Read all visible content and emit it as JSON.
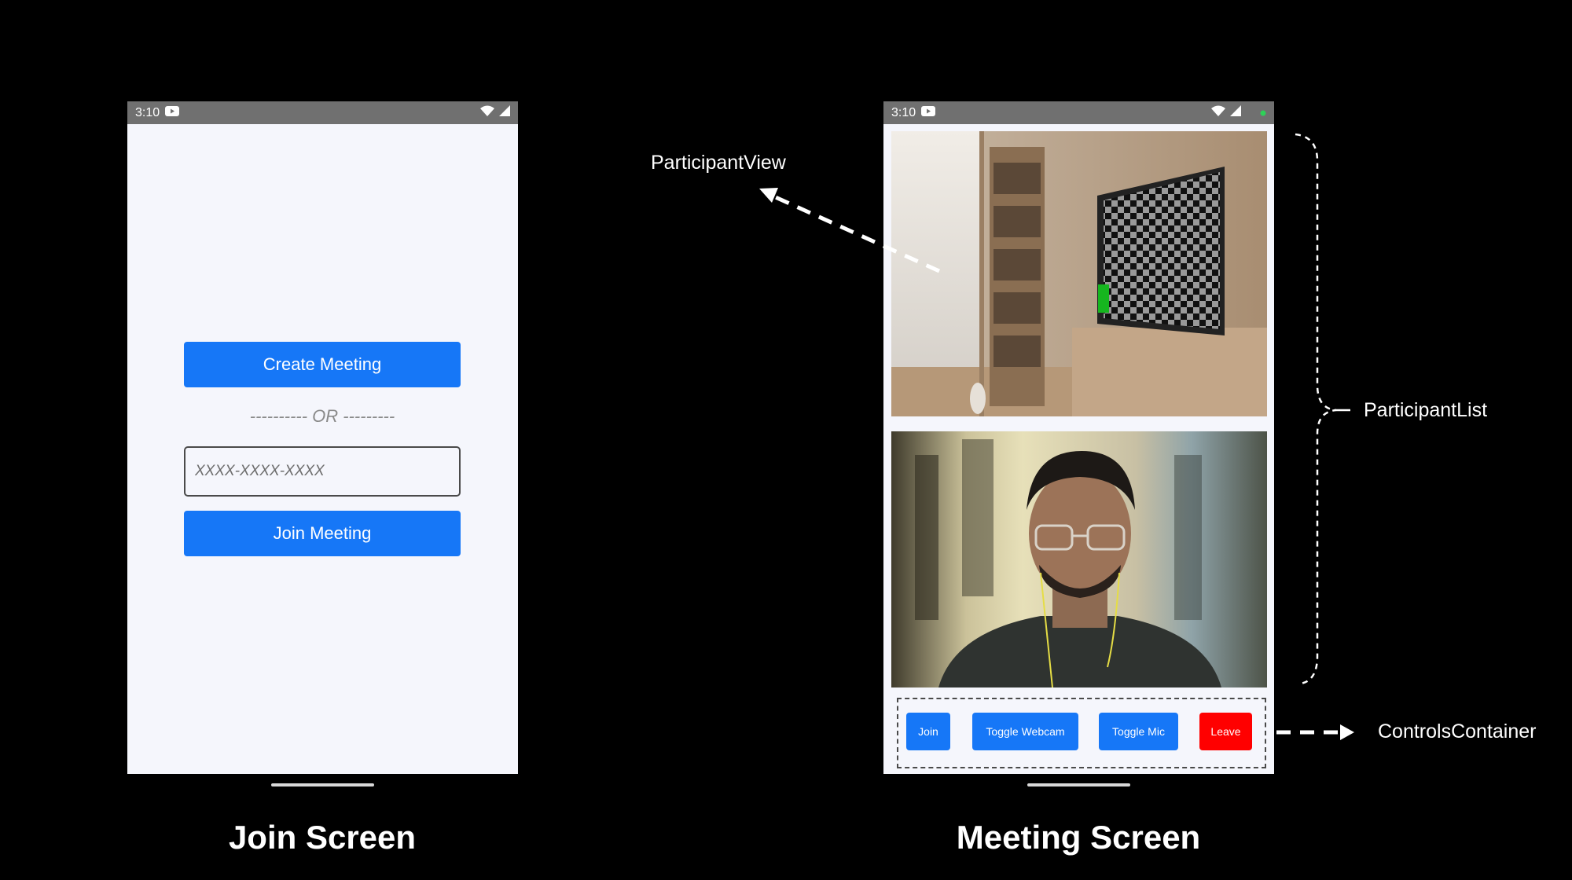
{
  "join_screen": {
    "status_time": "3:10",
    "create_button_label": "Create Meeting",
    "or_text": "---------- OR ---------",
    "meeting_id_placeholder": "XXXX-XXXX-XXXX",
    "join_button_label": "Join Meeting",
    "caption": "Join Screen"
  },
  "meeting_screen": {
    "status_time": "3:10",
    "controls": {
      "join_label": "Join",
      "toggle_webcam_label": "Toggle Webcam",
      "toggle_mic_label": "Toggle Mic",
      "leave_label": "Leave"
    },
    "caption": "Meeting Screen"
  },
  "annotations": {
    "participant_view": "ParticipantView",
    "participant_list": "ParticipantList",
    "controls_container": "ControlsContainer"
  },
  "colors": {
    "background": "#000000",
    "primary_button": "#1677f7",
    "leave_button": "#ff0000",
    "status_bar": "#707070",
    "screen_background": "#f5f6fc"
  },
  "icons": [
    "youtube-icon",
    "wifi-icon",
    "cellular-signal-icon",
    "green-dot-icon"
  ]
}
